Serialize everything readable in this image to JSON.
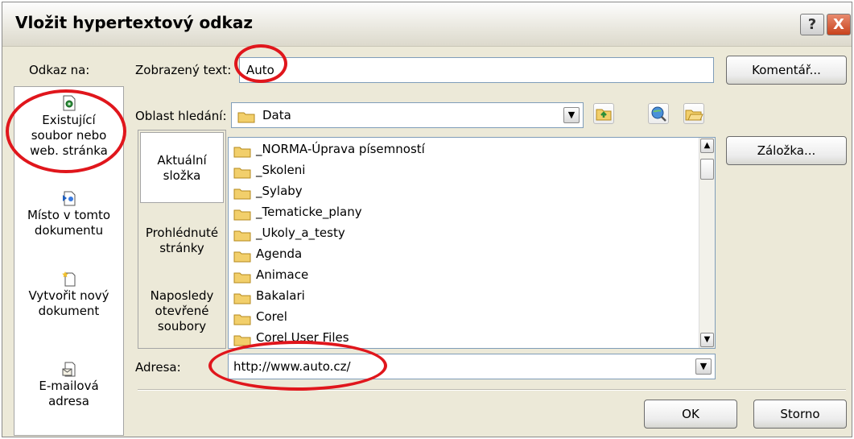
{
  "dialog": {
    "title": "Vložit hypertextový odkaz",
    "help_label": "?",
    "close_label": "X"
  },
  "link_to": {
    "label": "Odkaz na:",
    "items": [
      {
        "label_line1": "Existující",
        "label_line2": "soubor nebo",
        "label_line3": "web. stránka",
        "icon": "existing-file-icon"
      },
      {
        "label_line1": "Místo v tomto",
        "label_line2": "dokumentu",
        "icon": "place-in-document-icon"
      },
      {
        "label_line1": "Vytvořit nový",
        "label_line2": "dokument",
        "icon": "new-document-icon"
      },
      {
        "label_line1": "E-mailová",
        "label_line2": "adresa",
        "icon": "email-icon"
      }
    ]
  },
  "display_text": {
    "label": "Zobrazený text:",
    "value": "Auto"
  },
  "screentip_button": "Komentář...",
  "look_in": {
    "label": "Oblast hledání:",
    "value": "Data"
  },
  "bookmark_button": "Záložka...",
  "browse_bar": {
    "items": [
      {
        "line1": "Aktuální",
        "line2": "složka",
        "selected": true
      },
      {
        "line1": "Prohlédnuté",
        "line2": "stránky",
        "selected": false
      },
      {
        "line1": "Naposledy",
        "line2": "otevřené",
        "line3": "soubory",
        "selected": false
      }
    ]
  },
  "files": [
    "_NORMA-Úprava písemností",
    "_Skoleni",
    "_Sylaby",
    "_Tematicke_plany",
    "_Ukoly_a_testy",
    "Agenda",
    "Animace",
    "Bakalari",
    "Corel",
    "Corel User Files"
  ],
  "address": {
    "label": "Adresa:",
    "value": "http://www.auto.cz/"
  },
  "ok_button": "OK",
  "cancel_button": "Storno",
  "colors": {
    "dialog_bg": "#ece9d8",
    "highlight_ellipse": "#e0161c",
    "folder": "#f2cf6b"
  }
}
